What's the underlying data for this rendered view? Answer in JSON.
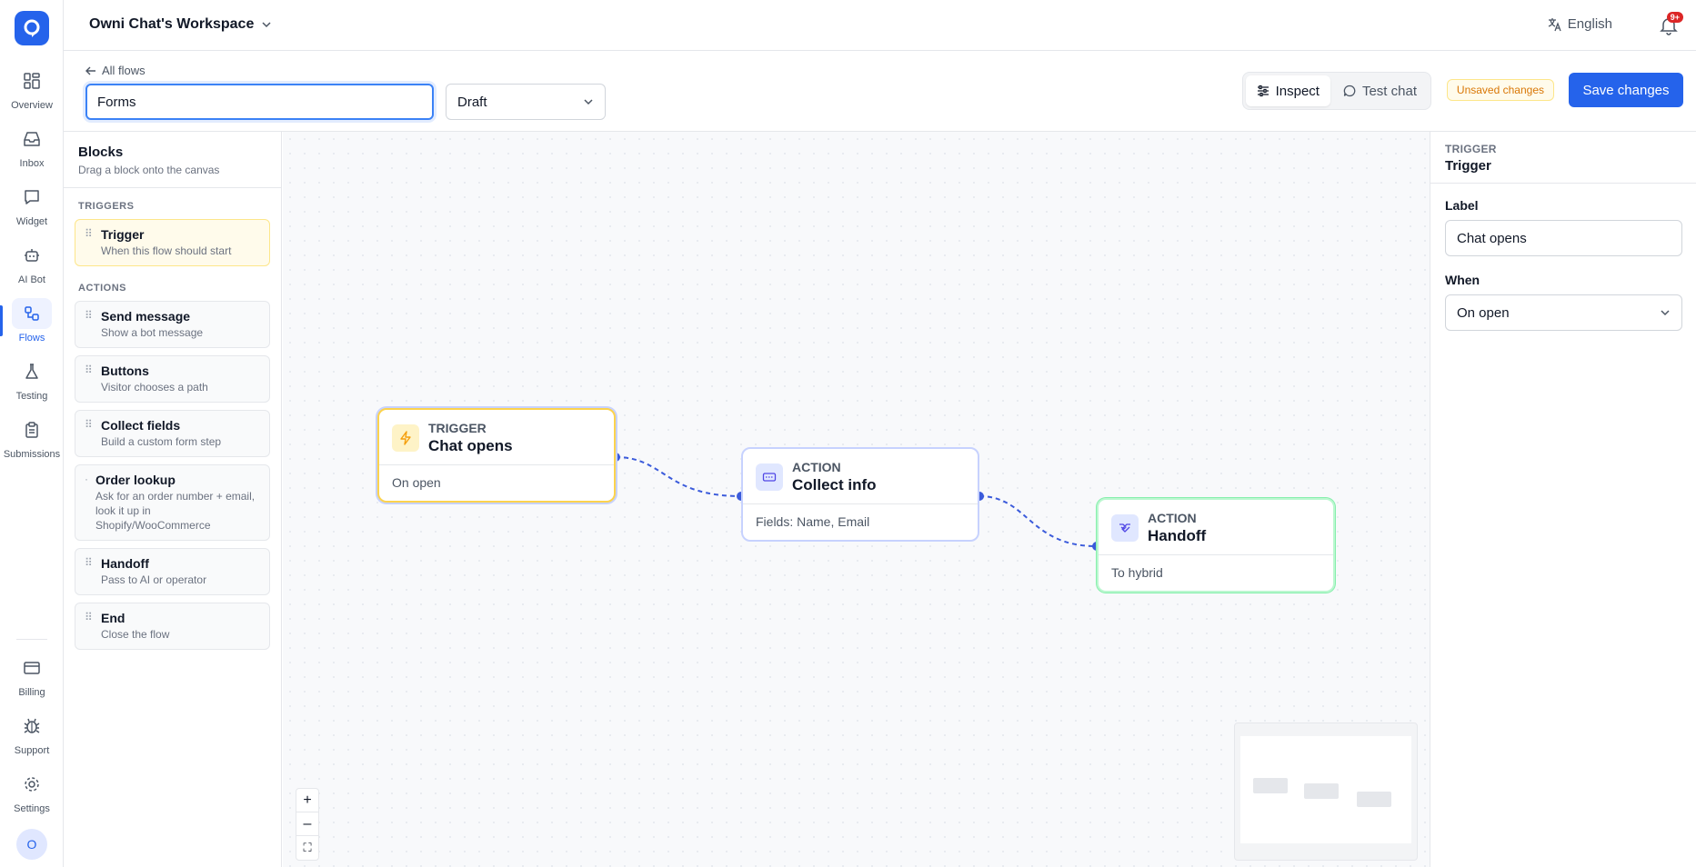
{
  "nav": {
    "items": [
      {
        "label": "Overview",
        "icon": "overview-icon"
      },
      {
        "label": "Inbox",
        "icon": "inbox-icon"
      },
      {
        "label": "Widget",
        "icon": "widget-icon"
      },
      {
        "label": "AI Bot",
        "icon": "bot-icon"
      },
      {
        "label": "Flows",
        "icon": "flows-icon"
      },
      {
        "label": "Testing",
        "icon": "flask-icon"
      },
      {
        "label": "Submissions",
        "icon": "clipboard-icon"
      }
    ],
    "bottom_items": [
      {
        "label": "Billing",
        "icon": "credit-card-icon"
      },
      {
        "label": "Support",
        "icon": "bug-icon"
      },
      {
        "label": "Settings",
        "icon": "gear-icon"
      }
    ],
    "avatar_initial": "O",
    "active": "Flows",
    "accent_color": "#2563eb"
  },
  "header": {
    "workspace": "Owni Chat's Workspace",
    "language": "English",
    "notification_badge": "9+"
  },
  "toolbar": {
    "back_label": "All flows",
    "flow_name": "Forms",
    "status": "Draft",
    "inspect_label": "Inspect",
    "test_chat_label": "Test chat",
    "unsaved_label": "Unsaved changes",
    "save_label": "Save changes"
  },
  "blocks": {
    "title": "Blocks",
    "subtitle": "Drag a block onto the canvas",
    "triggers_label": "TRIGGERS",
    "actions_label": "ACTIONS",
    "triggers": [
      {
        "title": "Trigger",
        "desc": "When this flow should start"
      }
    ],
    "actions": [
      {
        "title": "Send message",
        "desc": "Show a bot message"
      },
      {
        "title": "Buttons",
        "desc": "Visitor chooses a path"
      },
      {
        "title": "Collect fields",
        "desc": "Build a custom form step"
      },
      {
        "title": "Order lookup",
        "desc": "Ask for an order number + email, look it up in Shopify/WooCommerce"
      },
      {
        "title": "Handoff",
        "desc": "Pass to AI or operator"
      },
      {
        "title": "End",
        "desc": "Close the flow"
      }
    ]
  },
  "canvas": {
    "nodes": [
      {
        "kind": "TRIGGER",
        "title": "Chat opens",
        "body": "On open"
      },
      {
        "kind": "ACTION",
        "title": "Collect info",
        "body": "Fields: Name, Email"
      },
      {
        "kind": "ACTION",
        "title": "Handoff",
        "body": "To hybrid"
      }
    ],
    "zoom_in": "+",
    "zoom_out": "–",
    "fit": "⛶"
  },
  "inspector": {
    "kind": "TRIGGER",
    "title": "Trigger",
    "label_label": "Label",
    "label_value": "Chat opens",
    "when_label": "When",
    "when_value": "On open"
  }
}
